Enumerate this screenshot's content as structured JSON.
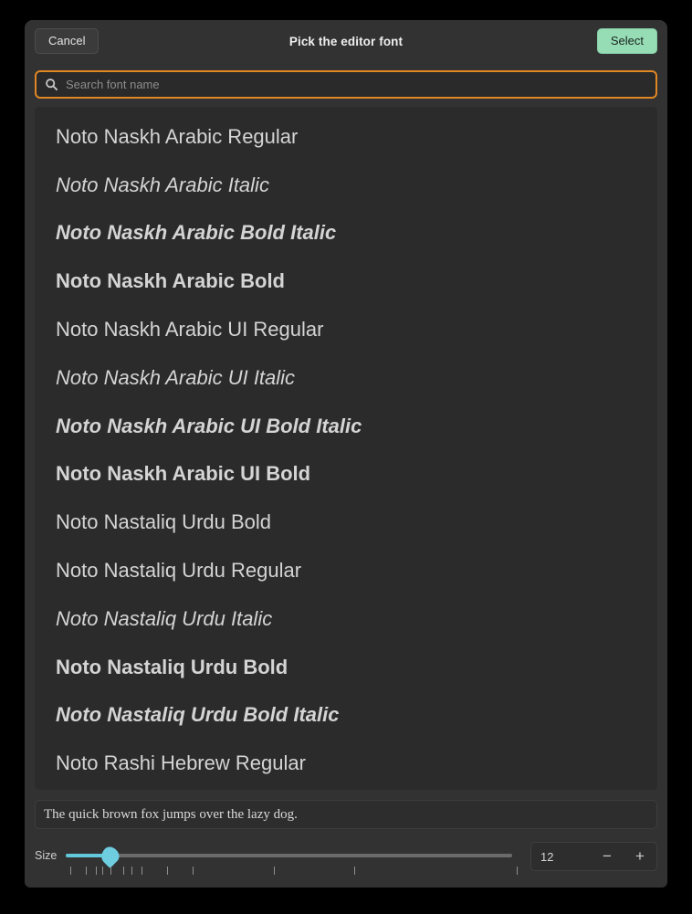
{
  "dialog": {
    "title": "Pick the editor font",
    "cancel_label": "Cancel",
    "select_label": "Select",
    "accent_green": "#96dcb5",
    "accent_orange": "#e08624",
    "accent_cyan": "#6fcde0",
    "background": "#323232",
    "list_background": "#2b2b2b"
  },
  "search": {
    "value": "",
    "placeholder": "Search font name",
    "icon": "search-icon"
  },
  "font_list": [
    {
      "label": "Noto Naskh Arabic Regular",
      "style": "s-regular"
    },
    {
      "label": "Noto Naskh Arabic Italic",
      "style": "s-italic"
    },
    {
      "label": "Noto Naskh Arabic Bold Italic",
      "style": "s-bolditalic"
    },
    {
      "label": "Noto Naskh Arabic Bold",
      "style": "s-bold"
    },
    {
      "label": "Noto Naskh Arabic UI Regular",
      "style": "s-regular"
    },
    {
      "label": "Noto Naskh Arabic UI Italic",
      "style": "s-italic"
    },
    {
      "label": "Noto Naskh Arabic UI Bold Italic",
      "style": "s-bolditalic"
    },
    {
      "label": "Noto Naskh Arabic UI Bold",
      "style": "s-bold"
    },
    {
      "label": "Noto Nastaliq Urdu Bold",
      "style": "s-regular"
    },
    {
      "label": "Noto Nastaliq Urdu Regular",
      "style": "s-regular"
    },
    {
      "label": "Noto Nastaliq Urdu Italic",
      "style": "s-italic"
    },
    {
      "label": "Noto Nastaliq Urdu Bold",
      "style": "s-bold"
    },
    {
      "label": "Noto Nastaliq Urdu Bold Italic",
      "style": "s-bolditalic"
    },
    {
      "label": "Noto Rashi Hebrew Regular",
      "style": "s-regular"
    }
  ],
  "preview": {
    "text": "The quick brown fox jumps over the lazy dog."
  },
  "size": {
    "label": "Size",
    "value": "12",
    "minus_label": "−",
    "plus_label": "+",
    "handle_percent": 9.9,
    "tick_percents": [
      1.0,
      4.5,
      6.6,
      8.1,
      10.0,
      12.9,
      14.7,
      17.0,
      22.6,
      28.4,
      46.5,
      64.7,
      101.0
    ]
  }
}
